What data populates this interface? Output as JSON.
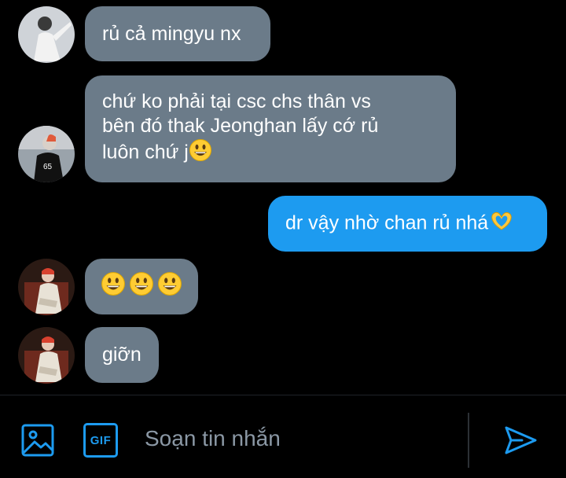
{
  "messages": [
    {
      "text": "rủ cả mingyu nx"
    },
    {
      "text": "chứ ko phải tại csc chs thân vs\nbên đó thak Jeonghan lấy cớ rủ\nluôn chứ j"
    },
    {
      "text": "dr vậy nhờ chan rủ nhá"
    },
    {
      "text": ""
    },
    {
      "text": "giỡn"
    }
  ],
  "composer": {
    "placeholder": "Soạn tin nhắn",
    "gif_label": "GIF"
  },
  "icons": {
    "image": "image-icon",
    "gif": "gif-icon",
    "send": "send-icon",
    "emoji": "grinning-face-emoji",
    "heart_hands": "heart-hands-emoji"
  },
  "colors": {
    "background": "#000000",
    "incoming_bubble": "#6b7b89",
    "outgoing_bubble": "#1d9bf0",
    "accent": "#1d9bf0",
    "placeholder": "#8b98a5"
  }
}
